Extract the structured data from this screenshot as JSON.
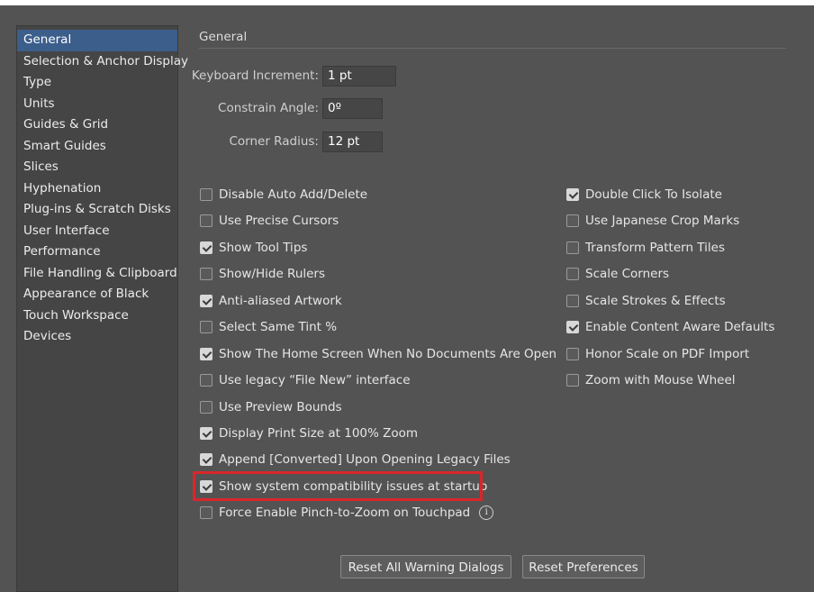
{
  "sidebar": {
    "items": [
      {
        "label": "General",
        "selected": true
      },
      {
        "label": "Selection & Anchor Display"
      },
      {
        "label": "Type"
      },
      {
        "label": "Units"
      },
      {
        "label": "Guides & Grid"
      },
      {
        "label": "Smart Guides"
      },
      {
        "label": "Slices"
      },
      {
        "label": "Hyphenation"
      },
      {
        "label": "Plug-ins & Scratch Disks"
      },
      {
        "label": "User Interface"
      },
      {
        "label": "Performance"
      },
      {
        "label": "File Handling & Clipboard"
      },
      {
        "label": "Appearance of Black"
      },
      {
        "label": "Touch Workspace"
      },
      {
        "label": "Devices"
      }
    ]
  },
  "general": {
    "title": "General",
    "keyboard_increment": {
      "label": "Keyboard Increment:",
      "value": "1 pt"
    },
    "constrain_angle": {
      "label": "Constrain Angle:",
      "value": "0º"
    },
    "corner_radius": {
      "label": "Corner Radius:",
      "value": "12 pt"
    }
  },
  "options_left": [
    {
      "label": "Disable Auto Add/Delete",
      "checked": false
    },
    {
      "label": "Use Precise Cursors",
      "checked": false
    },
    {
      "label": "Show Tool Tips",
      "checked": true
    },
    {
      "label": "Show/Hide Rulers",
      "checked": false
    },
    {
      "label": "Anti-aliased Artwork",
      "checked": true
    },
    {
      "label": "Select Same Tint %",
      "checked": false
    },
    {
      "label": "Show The Home Screen When No Documents Are Open",
      "checked": true
    },
    {
      "label": "Use legacy “File New” interface",
      "checked": false
    },
    {
      "label": "Use Preview Bounds",
      "checked": false
    },
    {
      "label": "Display Print Size at 100% Zoom",
      "checked": true
    },
    {
      "label": "Append [Converted] Upon Opening Legacy Files",
      "checked": true
    },
    {
      "label": "Show system compatibility issues at startup",
      "checked": true
    },
    {
      "label": "Force Enable Pinch-to-Zoom on Touchpad",
      "checked": false
    }
  ],
  "options_right": [
    {
      "label": "Double Click To Isolate",
      "checked": true
    },
    {
      "label": "Use Japanese Crop Marks",
      "checked": false
    },
    {
      "label": "Transform Pattern Tiles",
      "checked": false
    },
    {
      "label": "Scale Corners",
      "checked": false
    },
    {
      "label": "Scale Strokes & Effects",
      "checked": false
    },
    {
      "label": "Enable Content Aware Defaults",
      "checked": true
    },
    {
      "label": "Honor Scale on PDF Import",
      "checked": false
    },
    {
      "label": "Zoom with Mouse Wheel",
      "checked": false
    }
  ],
  "info_glyph": "i",
  "buttons": {
    "reset_warnings": "Reset All Warning Dialogs",
    "reset_prefs": "Reset Preferences"
  },
  "colors": {
    "panel_bg": "#535353",
    "sidebar_bg": "#454545",
    "selection": "#3c5e8b",
    "highlight_border": "#d9262b"
  }
}
